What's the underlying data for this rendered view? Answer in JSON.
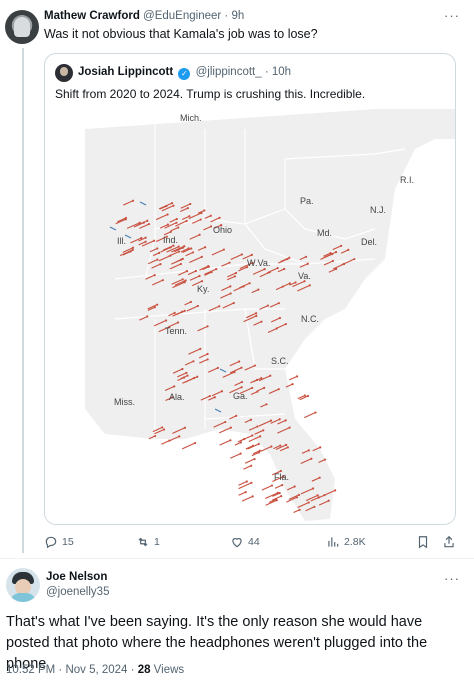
{
  "reply": {
    "name": "Mathew Crawford",
    "handle": "@EduEngineer",
    "separator": "·",
    "time": "9h",
    "text": "Was it not obvious that Kamala's job was to lose?",
    "more": "···"
  },
  "quote": {
    "name": "Josiah Lippincott",
    "handle": "@jlippincott_",
    "separator": "·",
    "time": "10h",
    "text": "Shift from 2020 to 2024. Trump is crushing this. Incredible.",
    "map_labels": {
      "mich": "Mich.",
      "pa": "Pa.",
      "ri": "R.I.",
      "nj": "N.J.",
      "ill": "Ill.",
      "ind": "Ind.",
      "ohio": "Ohio",
      "md": "Md.",
      "del": "Del.",
      "wva": "W.Va.",
      "va": "Va.",
      "ky": "Ky.",
      "nc": "N.C.",
      "tenn": "Tenn.",
      "sc": "S.C.",
      "miss": "Miss.",
      "ala": "Ala.",
      "ga": "Ga.",
      "fla": "Fla."
    },
    "colors": {
      "shift_arrow": "#c9503f",
      "dem_arrow": "#4a7fb5",
      "land": "#efefef",
      "water": "#ffffff"
    }
  },
  "stats": {
    "replies": "15",
    "reposts": "1",
    "likes": "44",
    "views": "2.8K"
  },
  "tweet": {
    "name": "Joe Nelson",
    "handle": "@joenelly35",
    "more": "···",
    "text": "That's what I've been saying. It's the only reason she would have posted that photo where the headphones weren't plugged into the phone",
    "time": "10:52 PM · Nov 5, 2024 · ",
    "views_count": "28",
    "views_label": " Views"
  }
}
